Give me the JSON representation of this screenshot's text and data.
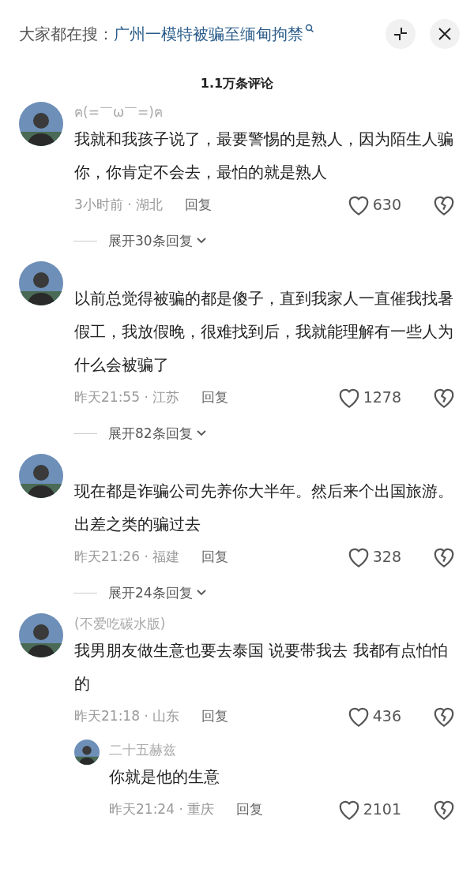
{
  "search": {
    "label": "大家都在搜：",
    "query": "广州一模特被骗至缅甸拘禁"
  },
  "comment_count": "1.1万条评论",
  "comments": [
    {
      "username": "ฅ(=￣ω￣=)ฅ",
      "text": "我就和我孩子说了，最要警惕的是熟人，因为陌生人骗你，你肯定不会去，最怕的就是熟人",
      "meta": "3小时前 · 湖北",
      "reply": "回复",
      "likes": "630",
      "expand": "展开30条回复"
    },
    {
      "text": "以前总觉得被骗的都是傻子，直到我家人一直催我找暑假工，我放假晚，很难找到后，我就能理解有一些人为什么会被骗了",
      "meta": "昨天21:55 · 江苏",
      "reply": "回复",
      "likes": "1278",
      "expand": "展开82条回复"
    },
    {
      "text": "现在都是诈骗公司先养你大半年。然后来个出国旅游。出差之类的骗过去",
      "meta": "昨天21:26 · 福建",
      "reply": "回复",
      "likes": "328",
      "expand": "展开24条回复"
    },
    {
      "username": "(不爱吃碳水版)",
      "text": "我男朋友做生意也要去泰国  说要带我去 我都有点怕怕的",
      "meta": "昨天21:18 · 山东",
      "reply": "回复",
      "likes": "436",
      "replies": [
        {
          "username": "二十五赫兹",
          "text": "你就是他的生意",
          "meta": "昨天21:24 · 重庆",
          "reply": "回复",
          "likes": "2101"
        }
      ]
    }
  ]
}
